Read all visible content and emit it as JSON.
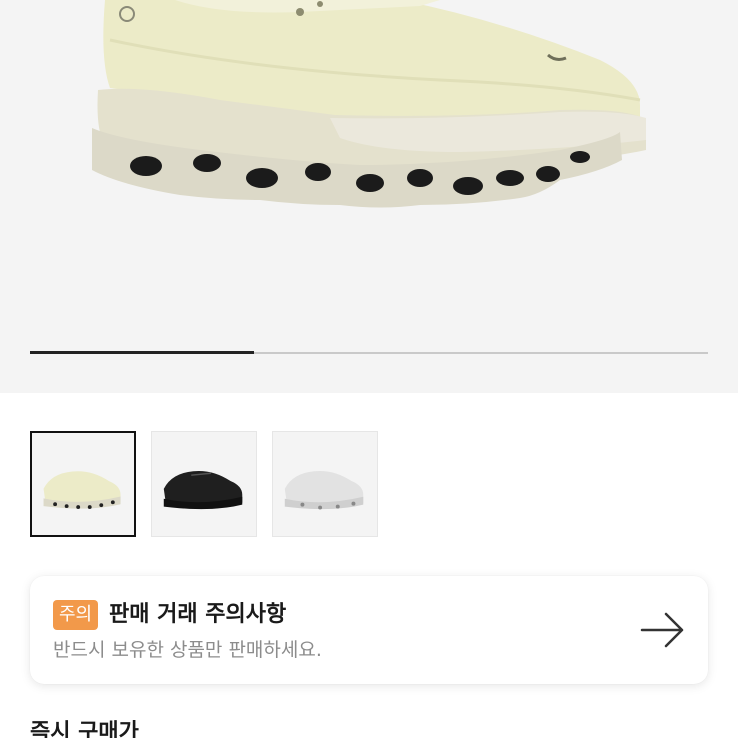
{
  "product": {
    "image_icon": "shoe-image",
    "gallery": {
      "progress": 0.33,
      "thumbnails": [
        {
          "icon": "cream-shoe-thumbnail",
          "selected": true
        },
        {
          "icon": "black-shoe-thumbnail",
          "selected": false
        },
        {
          "icon": "white-shoe-thumbnail",
          "selected": false
        }
      ]
    }
  },
  "notice": {
    "badge": "주의",
    "title": "판매 거래 주의사항",
    "subtitle": "반드시 보유한 상품만 판매하세요.",
    "arrow_icon": "arrow-right-icon",
    "badge_color": "#f2994a"
  },
  "section": {
    "label": "즉시 구매가"
  }
}
